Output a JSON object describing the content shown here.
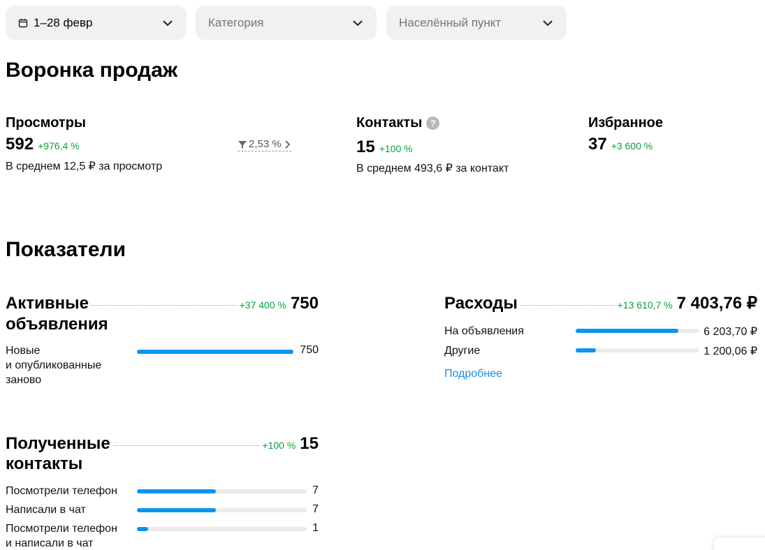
{
  "filters": {
    "period": "1–28 февр",
    "category_placeholder": "Категория",
    "location_placeholder": "Населённый пункт"
  },
  "funnel": {
    "title": "Воронка продаж",
    "views": {
      "label": "Просмотры",
      "value": "592",
      "delta": "+976,4 %",
      "sub": "В среднем 12,5 ₽ за просмотр",
      "conversion": "2,53 %"
    },
    "contacts": {
      "label": "Контакты",
      "help": "?",
      "value": "15",
      "delta": "+100 %",
      "sub": "В среднем 493,6 ₽ за контакт"
    },
    "favorites": {
      "label": "Избранное",
      "value": "37",
      "delta": "+3 600 %"
    }
  },
  "indicators": {
    "title": "Показатели",
    "active_ads": {
      "title_line1": "Активные",
      "title_line2": "объявления",
      "delta": "+37 400 %",
      "total": "750",
      "rows": [
        {
          "label_line1": "Новые",
          "label_line2": "и опубликованные",
          "label_line3": "заново",
          "value": "750",
          "fraction": 1.0
        }
      ]
    },
    "expenses": {
      "title": "Расходы",
      "delta": "+13 610,7 %",
      "total": "7 403,76 ₽",
      "rows": [
        {
          "label": "На объявления",
          "value": "6 203,70 ₽",
          "fraction": 0.838
        },
        {
          "label": "Другие",
          "value": "1 200,06 ₽",
          "fraction": 0.162
        }
      ],
      "link": "Подробнее"
    },
    "contacts": {
      "title_line1": "Полученные",
      "title_line2": "контакты",
      "delta": "+100 %",
      "total": "15",
      "rows": [
        {
          "label": "Посмотрели телефон",
          "value": "7",
          "fraction": 0.467
        },
        {
          "label": "Написали в чат",
          "value": "7",
          "fraction": 0.467
        },
        {
          "label_line1": "Посмотрели телефон",
          "label_line2": "и написали в чат",
          "value": "1",
          "fraction": 0.067
        }
      ]
    }
  },
  "colors": {
    "accent": "#0a95f0",
    "positive": "#04a33a",
    "link": "#1e8ce8",
    "filter_bg": "#f2f1f0",
    "bar_track": "#ebebeb"
  }
}
